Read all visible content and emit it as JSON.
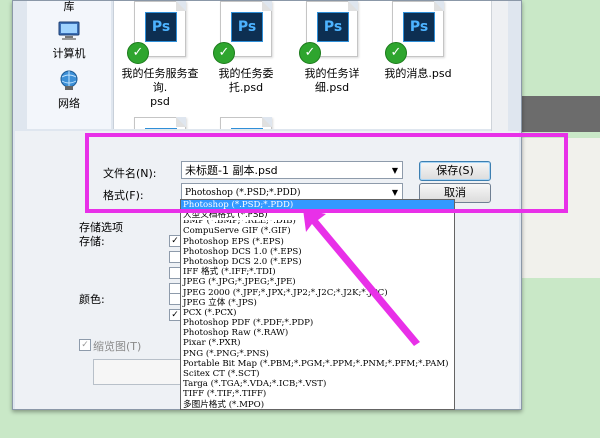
{
  "nav": {
    "top_label": "库",
    "items": [
      {
        "label": "计算机",
        "icon": "computer-icon"
      },
      {
        "label": "网络",
        "icon": "network-icon"
      }
    ]
  },
  "files": [
    {
      "name_line1": "我的任务服务查询.",
      "name_line2": "psd",
      "icon": "photoshop-file-icon"
    },
    {
      "name_line1": "我的任务委托.psd",
      "name_line2": "",
      "icon": "photoshop-file-icon"
    },
    {
      "name_line1": "我的任务详细.psd",
      "name_line2": "",
      "icon": "photoshop-file-icon"
    },
    {
      "name_line1": "我的消息.psd",
      "name_line2": "",
      "icon": "photoshop-file-icon"
    }
  ],
  "ps_badge": "Ps",
  "form": {
    "filename_label": "文件名(N):",
    "filename_value": "未标题-1 副本.psd",
    "format_label": "格式(F):",
    "format_value": "Photoshop (*.PSD;*.PDD)",
    "save_button": "保存(S)",
    "cancel_button": "取消",
    "save_options_label": "存储选项",
    "storage_label": "存储:",
    "color_label": "颜色:",
    "thumbnail_label": "缩览图(T)"
  },
  "format_options": [
    "Photoshop (*.PSD;*.PDD)",
    "大型文档格式 (*.PSB)",
    "BMP (*.BMP;*.RLE;*.DIB)",
    "CompuServe GIF (*.GIF)",
    "Photoshop EPS (*.EPS)",
    "Photoshop DCS 1.0 (*.EPS)",
    "Photoshop DCS 2.0 (*.EPS)",
    "IFF 格式 (*.IFF;*.TDI)",
    "JPEG (*.JPG;*.JPEG;*.JPE)",
    "JPEG 2000 (*.JPF;*.JPX;*.JP2;*.J2C;*.J2K;*.JPC)",
    "JPEG 立体 (*.JPS)",
    "PCX (*.PCX)",
    "Photoshop PDF (*.PDF;*.PDP)",
    "Photoshop Raw (*.RAW)",
    "Pixar (*.PXR)",
    "PNG (*.PNG;*.PNS)",
    "Portable Bit Map (*.PBM;*.PGM;*.PPM;*.PNM;*.PFM;*.PAM)",
    "Scitex CT (*.SCT)",
    "Targa (*.TGA;*.VDA;*.ICB;*.VST)",
    "TIFF (*.TIF;*.TIFF)",
    "多图片格式 (*.MPO)"
  ],
  "selected_option_index": 0,
  "colors": {
    "highlight": "#e830e8",
    "selection": "#3399ff",
    "background": "#c9e8c7"
  }
}
